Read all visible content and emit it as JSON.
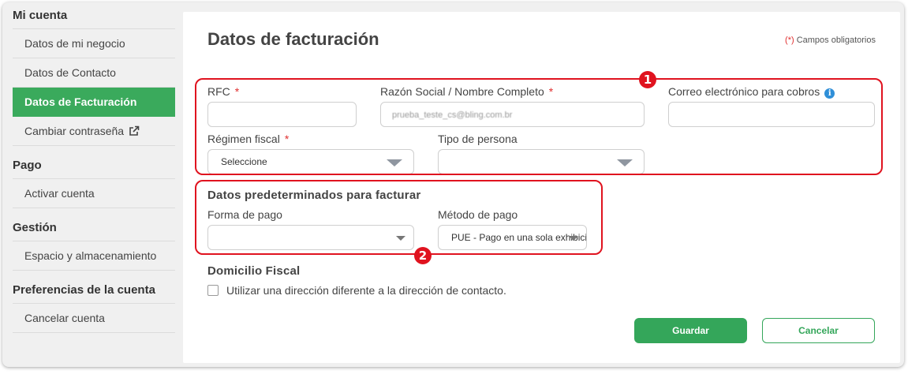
{
  "sidebar": {
    "groups": [
      {
        "heading": "Mi cuenta",
        "items": [
          "Datos de mi negocio",
          "Datos de Contacto",
          "Datos de Facturación",
          "Cambiar contraseña"
        ]
      },
      {
        "heading": "Pago",
        "items": [
          "Activar cuenta"
        ]
      },
      {
        "heading": "Gestión",
        "items": [
          "Espacio y almacenamiento"
        ]
      },
      {
        "heading": "Preferencias de la cuenta",
        "items": [
          "Cancelar cuenta"
        ]
      }
    ],
    "active_item": "Datos de Facturación",
    "external_link_icon": "external-link-icon"
  },
  "main": {
    "title": "Datos de facturación",
    "required_note_marker": "(*)",
    "required_note": " Campos obligatorios",
    "required_marker": "*",
    "fields": {
      "rfc": {
        "label": "RFC",
        "value": ""
      },
      "razon_social": {
        "label": "Razón Social / Nombre Completo",
        "value": "prueba_teste_cs@bling.com.br"
      },
      "correo": {
        "label": "Correo electrónico para cobros",
        "value": "",
        "info_icon": "info-icon"
      },
      "regimen": {
        "label": "Régimen fiscal",
        "value": "Seleccione"
      },
      "tipo_persona": {
        "label": "Tipo de persona",
        "value": ""
      }
    },
    "defaults_section": {
      "title": "Datos predeterminados para facturar",
      "forma_pago": {
        "label": "Forma de pago",
        "value": ""
      },
      "metodo_pago": {
        "label": "Método de pago",
        "value": "PUE - Pago en una sola exhibición"
      }
    },
    "domicilio": {
      "title": "Domicilio Fiscal",
      "checkbox_label": "Utilizar una dirección diferente a la dirección de contacto.",
      "checked": false
    },
    "buttons": {
      "save": "Guardar",
      "cancel": "Cancelar"
    }
  },
  "annotations": {
    "one": "1",
    "two": "2",
    "color": "#e0131f"
  },
  "colors": {
    "accent": "#3aaa5c",
    "required": "#e03030",
    "info": "#2f8fd8"
  }
}
